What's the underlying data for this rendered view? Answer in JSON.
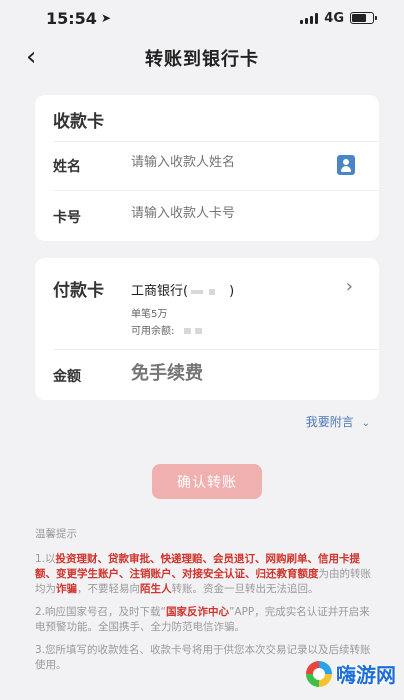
{
  "status_bar": {
    "time": "15:54",
    "network": "4G"
  },
  "nav": {
    "title": "转账到银行卡"
  },
  "payee_card": {
    "title": "收款卡",
    "name_label": "姓名",
    "name_placeholder": "请输入收款人姓名",
    "card_label": "卡号",
    "card_placeholder": "请输入收款人卡号"
  },
  "payer_card": {
    "title": "付款卡",
    "bank_prefix": "工商银行(",
    "bank_suffix": ")",
    "single_limit": "单笔5万",
    "available_label": "可用余额:",
    "amount_label": "金额",
    "amount_placeholder": "免手续费"
  },
  "attach_link": "我要附言",
  "confirm_button": "确认转账",
  "tips": {
    "title": "温馨提示",
    "tip1_parts": [
      {
        "text": "1.以",
        "hl": false
      },
      {
        "text": "投资理财、贷款审批、快递理赔、会员退订、网购刷单、信用卡提额、变更学生账户、注销账户、对接安全认证、归还教育额度",
        "hl": true
      },
      {
        "text": "为由的转账均为",
        "hl": false
      },
      {
        "text": "诈骗",
        "hl": true
      },
      {
        "text": "，不要轻易向",
        "hl": false
      },
      {
        "text": "陌生人",
        "hl": true
      },
      {
        "text": "转账。资金一旦转出无法追回。",
        "hl": false
      }
    ],
    "tip2_parts": [
      {
        "text": "2.响应国家号召，及时下载“",
        "hl": false
      },
      {
        "text": "国家反诈中心",
        "hl": true
      },
      {
        "text": "”APP，完成实名认证并开启来电预警功能。全国携手、全力防范电信诈骗。",
        "hl": false
      }
    ],
    "tip3": "3.您所填写的收款姓名、收款卡号将用于供您本次交易记录以及后续转账使用。"
  },
  "watermark": {
    "text": "嗨游网"
  },
  "colors": {
    "primary_disabled": "#f0b0b0",
    "highlight": "#d0342c",
    "link": "#4a78b8"
  }
}
